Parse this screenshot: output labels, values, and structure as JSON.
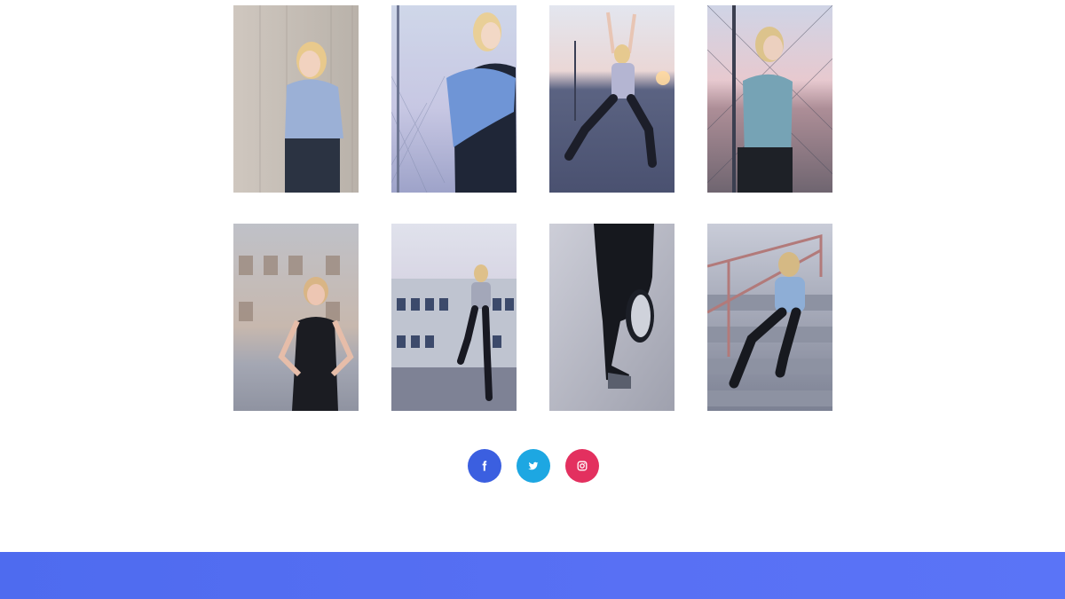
{
  "gallery": {
    "photos": [
      {
        "name": "photo-woman-leaning-on-metal-wall",
        "icon": "photo"
      },
      {
        "name": "photo-woman-adjusting-ponytail-by-fence",
        "icon": "photo"
      },
      {
        "name": "photo-woman-lunge-arms-raised-sunset",
        "icon": "photo"
      },
      {
        "name": "photo-woman-in-hoodie-by-chainlink-fence",
        "icon": "photo"
      },
      {
        "name": "photo-woman-hands-on-hips",
        "icon": "photo"
      },
      {
        "name": "photo-woman-jumping-by-building",
        "icon": "photo"
      },
      {
        "name": "photo-runner-legs-closeup",
        "icon": "photo"
      },
      {
        "name": "photo-woman-sitting-on-stairs",
        "icon": "photo"
      }
    ]
  },
  "social": {
    "facebook": {
      "icon": "facebook-icon",
      "color": "#3b5fe0"
    },
    "twitter": {
      "icon": "twitter-icon",
      "color": "#1da7e2"
    },
    "instagram": {
      "icon": "instagram-icon",
      "color": "#e3305f"
    }
  },
  "footer": {
    "color": "#5370f2"
  }
}
